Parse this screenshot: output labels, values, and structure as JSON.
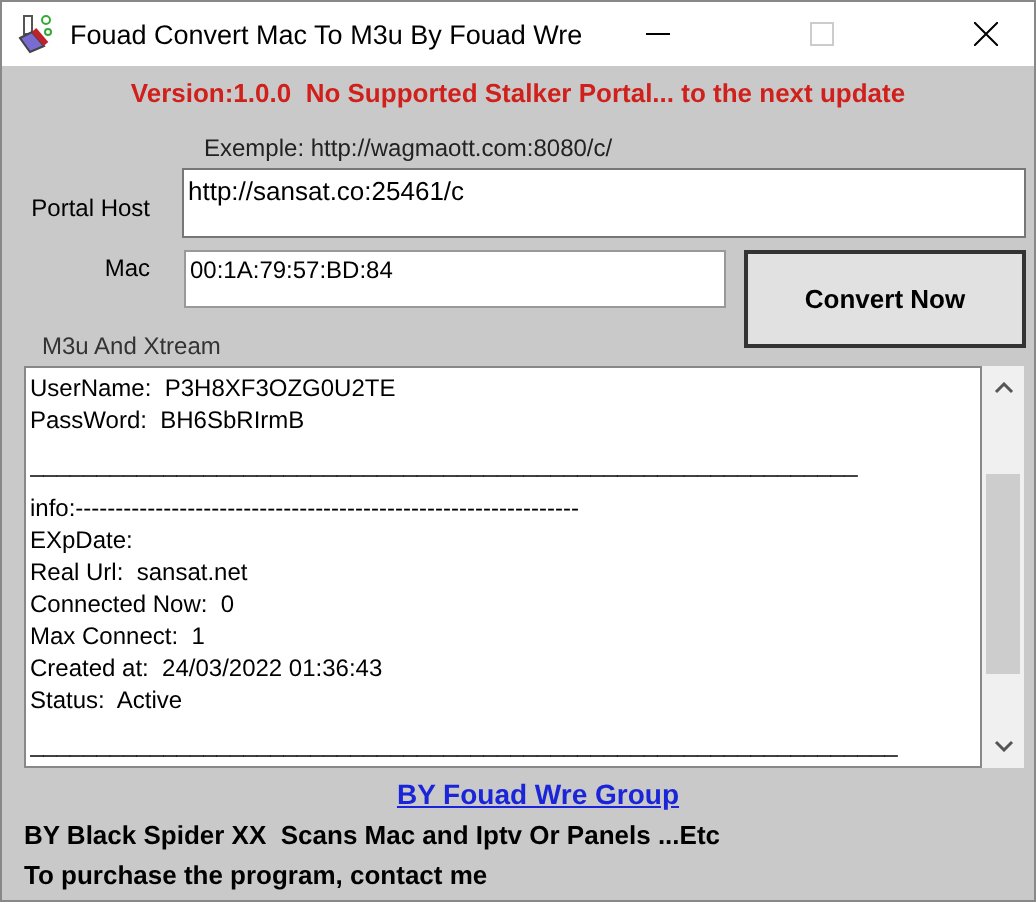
{
  "window": {
    "title": "Fouad Convert Mac To M3u By Fouad Wre"
  },
  "version_notice": "Version:1.0.0  No Supported Stalker Portal... to the next update",
  "example_hint": "Exemple: http://wagmaott.com:8080/c/",
  "portal_host": {
    "label": "Portal Host",
    "value": "http://sansat.co:25461/c"
  },
  "mac": {
    "label": "Mac",
    "value": "00:1A:79:57:BD:84"
  },
  "convert_button": "Convert Now",
  "output": {
    "label": "M3u And Xtream",
    "lines": [
      {
        "kind": "text",
        "text": "UserName:  P3H8XF3OZG0U2TE"
      },
      {
        "kind": "text",
        "text": "PassWord:  BH6SbRIrmB"
      },
      {
        "kind": "gap"
      },
      {
        "kind": "text",
        "text": "______________________________________________________________"
      },
      {
        "kind": "gap"
      },
      {
        "kind": "text",
        "text": "info:---------------------------------------------------------------"
      },
      {
        "kind": "text",
        "text": "EXpDate:"
      },
      {
        "kind": "text",
        "text": "Real Url:  sansat.net"
      },
      {
        "kind": "text",
        "text": "Connected Now:  0"
      },
      {
        "kind": "text",
        "text": "Max Connect:  1"
      },
      {
        "kind": "text",
        "text": "Created at:  24/03/2022 01:36:43"
      },
      {
        "kind": "text",
        "text": "Status:  Active"
      },
      {
        "kind": "gap"
      },
      {
        "kind": "text",
        "text": "_________________________________________________________________"
      }
    ]
  },
  "link": "BY Fouad Wre Group",
  "credits": "BY Black Spider XX  Scans Mac and Iptv Or Panels ...Etc",
  "purchase_note": "To purchase the program, contact me"
}
